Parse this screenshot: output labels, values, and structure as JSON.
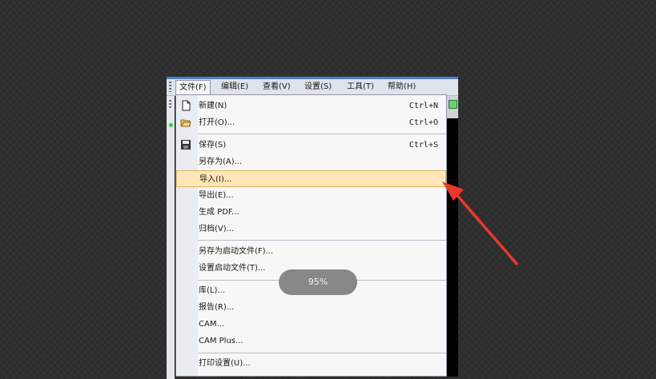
{
  "menubar": {
    "items": [
      "文件(F)",
      "编辑(E)",
      "查看(V)",
      "设置(S)",
      "工具(T)",
      "帮助(H)"
    ]
  },
  "file_menu": {
    "items": [
      {
        "label": "新建(N)",
        "shortcut": "Ctrl+N",
        "icon": "new-file-icon"
      },
      {
        "label": "打开(O)...",
        "shortcut": "Ctrl+O",
        "icon": "open-folder-icon"
      },
      {
        "label": "保存(S)",
        "shortcut": "Ctrl+S",
        "icon": "save-icon"
      },
      {
        "label": "另存为(A)...",
        "shortcut": ""
      },
      {
        "label": "导入(I)...",
        "shortcut": "",
        "highlighted": true
      },
      {
        "label": "导出(E)...",
        "shortcut": ""
      },
      {
        "label": "生成 PDF...",
        "shortcut": ""
      },
      {
        "label": "归档(V)...",
        "shortcut": ""
      },
      {
        "label": "另存为启动文件(F)...",
        "shortcut": ""
      },
      {
        "label": "设置启动文件(T)...",
        "shortcut": ""
      },
      {
        "label": "库(L)...",
        "shortcut": ""
      },
      {
        "label": "报告(R)...",
        "shortcut": ""
      },
      {
        "label": "CAM...",
        "shortcut": ""
      },
      {
        "label": "CAM Plus...",
        "shortcut": ""
      },
      {
        "label": "打印设置(U)...",
        "shortcut": ""
      }
    ]
  },
  "overlay": {
    "zoom_text": "95%"
  },
  "colors": {
    "highlight": "#ffe6b8",
    "arrow": "#e8392b",
    "titlebar": "#4a7ec9"
  }
}
